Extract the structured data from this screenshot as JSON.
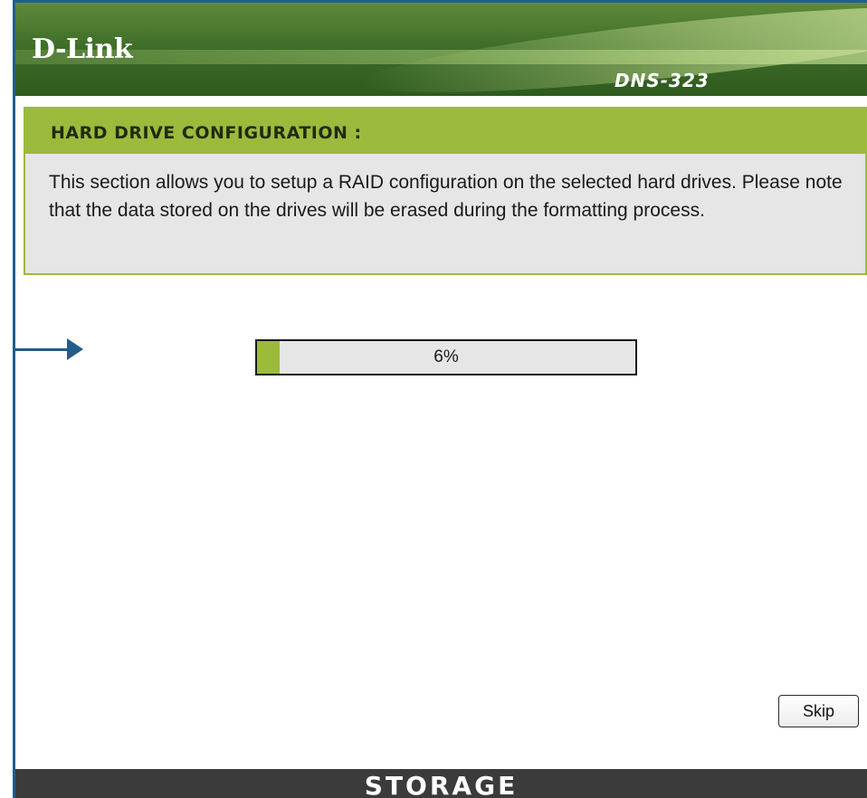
{
  "header": {
    "logo_text": "D-Link",
    "model": "DNS-323"
  },
  "section": {
    "title": "HARD DRIVE CONFIGURATION :",
    "description": "This section allows you to setup a RAID configuration on the selected hard drives. Please note that the data stored on the drives will be erased during the formatting process."
  },
  "progress": {
    "percent": 6,
    "label": "6%"
  },
  "actions": {
    "skip_label": "Skip"
  },
  "footer": {
    "label": "STORAGE"
  },
  "colors": {
    "accent": "#9cba3c",
    "header": "#3f6f2a",
    "annotation": "#1f5e8a",
    "footer": "#3b3b3b"
  }
}
